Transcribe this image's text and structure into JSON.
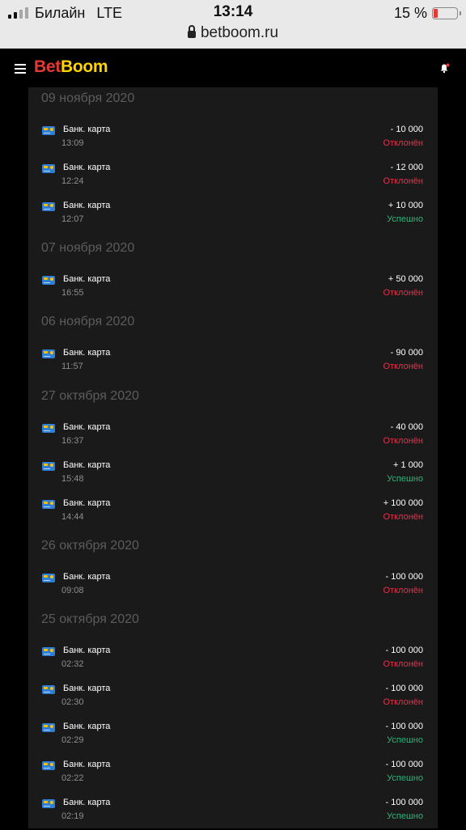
{
  "status_bar": {
    "carrier": "Билайн",
    "network": "LTE",
    "time": "13:14",
    "battery": "15 %",
    "battery_level_percent": 15
  },
  "url_bar": {
    "url": "betboom.ru"
  },
  "header": {
    "logo_part1": "Bet",
    "logo_part2": "Boom"
  },
  "colors": {
    "rejected": "#e8304a",
    "success": "#26b57a",
    "logo_red": "#e53935",
    "logo_yellow": "#ffd400"
  },
  "groups": [
    {
      "date": "09 ноября 2020",
      "items": [
        {
          "method": "Банк. карта",
          "time": "13:09",
          "amount": "- 10 000",
          "status": "Отклонён",
          "state": "rejected"
        },
        {
          "method": "Банк. карта",
          "time": "12:24",
          "amount": "- 12 000",
          "status": "Отклонён",
          "state": "rejected"
        },
        {
          "method": "Банк. карта",
          "time": "12:07",
          "amount": "+ 10 000",
          "status": "Успешно",
          "state": "success"
        }
      ]
    },
    {
      "date": "07 ноября 2020",
      "items": [
        {
          "method": "Банк. карта",
          "time": "16:55",
          "amount": "+ 50 000",
          "status": "Отклонён",
          "state": "rejected"
        }
      ]
    },
    {
      "date": "06 ноября 2020",
      "items": [
        {
          "method": "Банк. карта",
          "time": "11:57",
          "amount": "- 90 000",
          "status": "Отклонён",
          "state": "rejected"
        }
      ]
    },
    {
      "date": "27 октября 2020",
      "items": [
        {
          "method": "Банк. карта",
          "time": "16:37",
          "amount": "- 40 000",
          "status": "Отклонён",
          "state": "rejected"
        },
        {
          "method": "Банк. карта",
          "time": "15:48",
          "amount": "+ 1 000",
          "status": "Успешно",
          "state": "success"
        },
        {
          "method": "Банк. карта",
          "time": "14:44",
          "amount": "+ 100 000",
          "status": "Отклонён",
          "state": "rejected"
        }
      ]
    },
    {
      "date": "26 октября 2020",
      "items": [
        {
          "method": "Банк. карта",
          "time": "09:08",
          "amount": "- 100 000",
          "status": "Отклонён",
          "state": "rejected"
        }
      ]
    },
    {
      "date": "25 октября 2020",
      "items": [
        {
          "method": "Банк. карта",
          "time": "02:32",
          "amount": "- 100 000",
          "status": "Отклонён",
          "state": "rejected"
        },
        {
          "method": "Банк. карта",
          "time": "02:30",
          "amount": "- 100 000",
          "status": "Отклонён",
          "state": "rejected"
        },
        {
          "method": "Банк. карта",
          "time": "02:29",
          "amount": "- 100 000",
          "status": "Успешно",
          "state": "success"
        },
        {
          "method": "Банк. карта",
          "time": "02:22",
          "amount": "- 100 000",
          "status": "Успешно",
          "state": "success"
        },
        {
          "method": "Банк. карта",
          "time": "02:19",
          "amount": "- 100 000",
          "status": "Успешно",
          "state": "success"
        }
      ]
    }
  ]
}
